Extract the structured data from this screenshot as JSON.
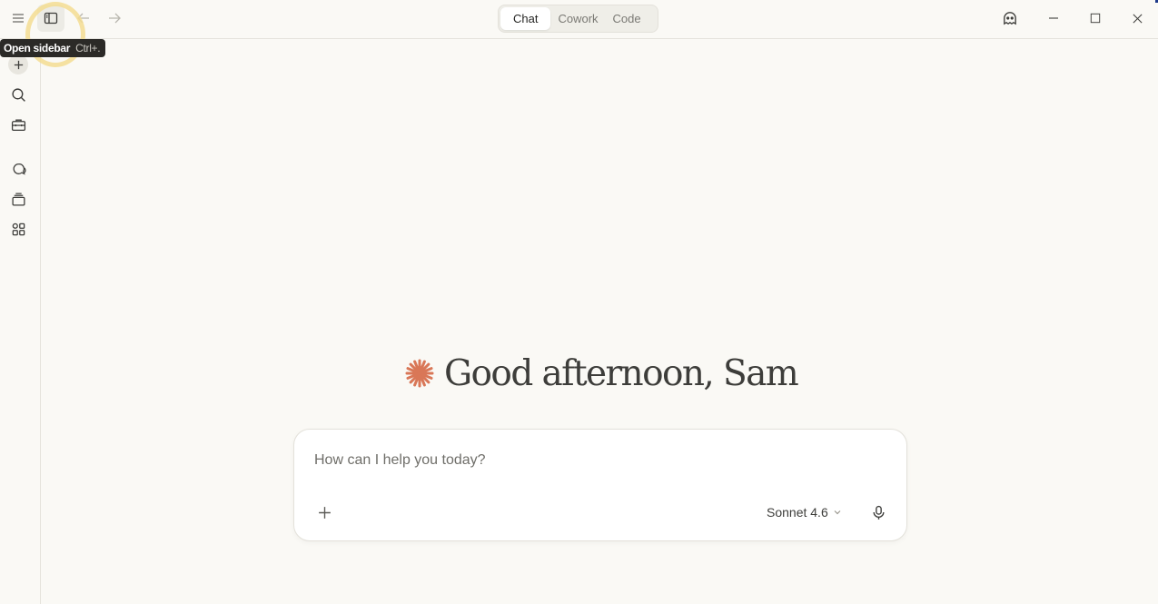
{
  "titlebar": {
    "modes": [
      {
        "label": "Chat",
        "selected": true
      },
      {
        "label": "Cowork",
        "selected": false
      },
      {
        "label": "Code",
        "selected": false
      }
    ]
  },
  "tooltip": {
    "label": "Open sidebar",
    "shortcut": "Ctrl+."
  },
  "sidebar": {
    "icons": [
      "new-chat-icon",
      "search-icon",
      "toolbox-icon",
      "chats-icon",
      "projects-icon",
      "artifacts-icon"
    ]
  },
  "main": {
    "greeting": "Good afternoon, Sam",
    "accent_color": "#d97757"
  },
  "composer": {
    "placeholder": "How can I help you today?",
    "value": "",
    "model": "Sonnet 4.6"
  }
}
